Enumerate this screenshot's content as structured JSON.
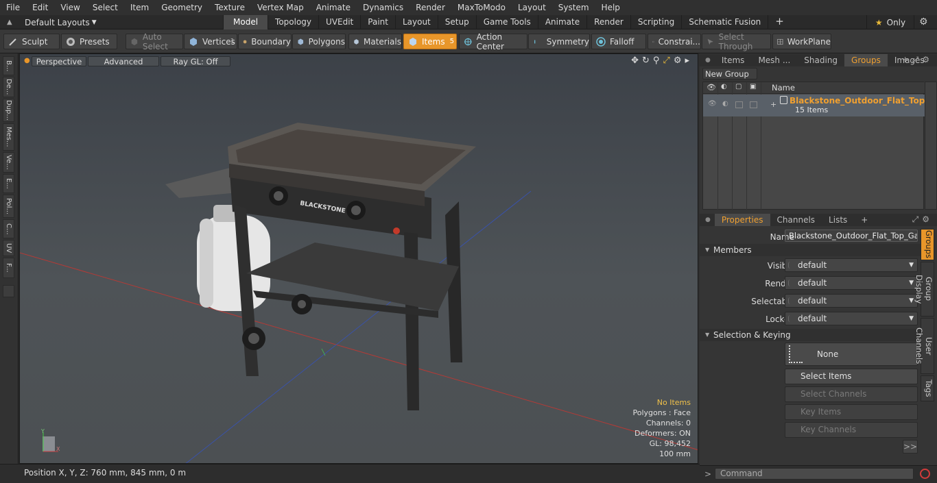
{
  "menu": [
    "File",
    "Edit",
    "View",
    "Select",
    "Item",
    "Geometry",
    "Texture",
    "Vertex Map",
    "Animate",
    "Dynamics",
    "Render",
    "MaxToModo",
    "Layout",
    "System",
    "Help"
  ],
  "layout_selector": "Default Layouts",
  "mode_tabs": [
    "Model",
    "Topology",
    "UVEdit",
    "Paint",
    "Layout",
    "Setup",
    "Game Tools",
    "Animate",
    "Render",
    "Scripting",
    "Schematic Fusion"
  ],
  "active_mode_tab": "Model",
  "only_label": "Only",
  "toolbar": {
    "sculpt": "Sculpt",
    "presets": "Presets",
    "auto_select": "Auto Select",
    "vertices": "Vertices",
    "vertices_count": "1",
    "boundary": "Boundary",
    "polygons": "Polygons",
    "materials": "Materials",
    "items": "Items",
    "items_count": "5",
    "action_center": "Action Center",
    "symmetry": "Symmetry",
    "falloff": "Falloff",
    "constraints": "Constrai...",
    "select_through": "Select Through",
    "workplane": "WorkPlane"
  },
  "left_strip": [
    "B...",
    "De...",
    "Dup...",
    "Mes...",
    "Ve...",
    "E...",
    "Pol...",
    "C...",
    "UV",
    "F..."
  ],
  "viewport": {
    "perspective": "Perspective",
    "advanced": "Advanced",
    "raygl": "Ray GL: Off",
    "info": {
      "items": "No Items",
      "polygons": "Polygons : Face",
      "channels": "Channels: 0",
      "deformers": "Deformers: ON",
      "gl": "GL: 98,452",
      "scale": "100 mm"
    },
    "model_labels": {
      "brand": "BLACKSTONE"
    }
  },
  "status": {
    "position": "Position X, Y, Z:   760 mm, 845 mm, 0 m"
  },
  "top_panel": {
    "tabs": [
      "Items",
      "Mesh ...",
      "Shading",
      "Groups",
      "Images"
    ],
    "active_tab": "Groups",
    "new_group": "New Group",
    "column_name": "Name",
    "group_name": "Blackstone_Outdoor_Flat_Top_ ...",
    "group_count": "15 Items"
  },
  "properties_panel": {
    "tabs": [
      "Properties",
      "Channels",
      "Lists"
    ],
    "active_tab": "Properties",
    "name_label": "Name",
    "name_value": "Blackstone_Outdoor_Flat_Top_Gas_G",
    "members_section": "Members",
    "rows": [
      {
        "label": "Visible",
        "value": "default"
      },
      {
        "label": "Render",
        "value": "default"
      },
      {
        "label": "Selectable",
        "value": "default"
      },
      {
        "label": "Locked",
        "value": "default"
      }
    ],
    "sel_section": "Selection & Keying",
    "none_btn": "None",
    "select_items": "Select Items",
    "select_channels": "Select Channels",
    "key_items": "Key Items",
    "key_channels": "Key Channels",
    "more": ">>"
  },
  "side_tabs": [
    "Groups",
    "Group Display",
    "User Channels",
    "Tags"
  ],
  "command": {
    "placeholder": "Command",
    "prompt": ">"
  },
  "colors": {
    "accent": "#e8962a",
    "group_name": "#f0a030",
    "warning": "#f0c14a"
  }
}
